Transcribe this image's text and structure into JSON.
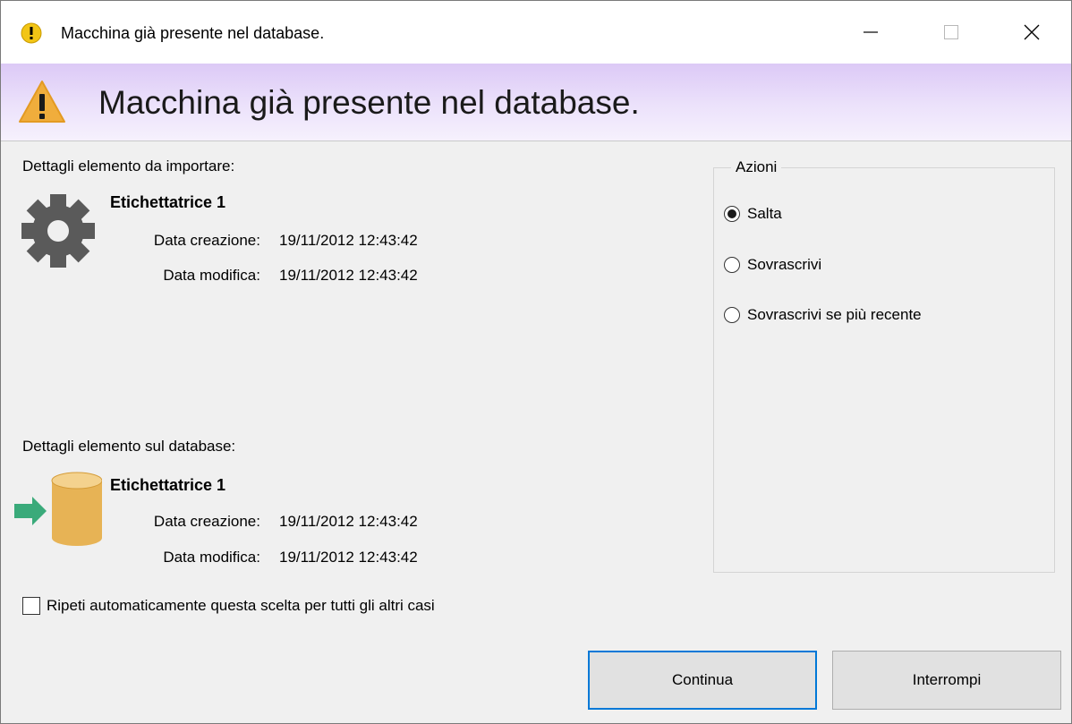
{
  "window": {
    "title": "Macchina già presente nel database."
  },
  "banner": {
    "heading": "Macchina già presente nel database."
  },
  "import_item": {
    "section_label": "Dettagli elemento da importare:",
    "name": "Etichettatrice 1",
    "created_label": "Data creazione:",
    "created_value": "19/11/2012 12:43:42",
    "modified_label": "Data modifica:",
    "modified_value": "19/11/2012 12:43:42",
    "icon": "gear-icon"
  },
  "db_item": {
    "section_label": "Dettagli elemento sul database:",
    "name": "Etichettatrice 1",
    "created_label": "Data creazione:",
    "created_value": "19/11/2012 12:43:42",
    "modified_label": "Data modifica:",
    "modified_value": "19/11/2012 12:43:42",
    "icon": "database-arrow-icon"
  },
  "actions": {
    "legend": "Azioni",
    "options": [
      {
        "label": "Salta",
        "checked": true
      },
      {
        "label": "Sovrascrivi",
        "checked": false
      },
      {
        "label": "Sovrascrivi se più recente",
        "checked": false
      }
    ]
  },
  "repeat_checkbox": {
    "label": "Ripeti automaticamente questa scelta per tutti gli altri casi",
    "checked": false
  },
  "buttons": {
    "continue_label": "Continua",
    "stop_label": "Interrompi"
  },
  "colors": {
    "accent": "#0078d7",
    "banner": "#dcc9f6",
    "warning": "#f0ad3c",
    "database": "#e7b355",
    "arrow": "#3aaa7a"
  }
}
